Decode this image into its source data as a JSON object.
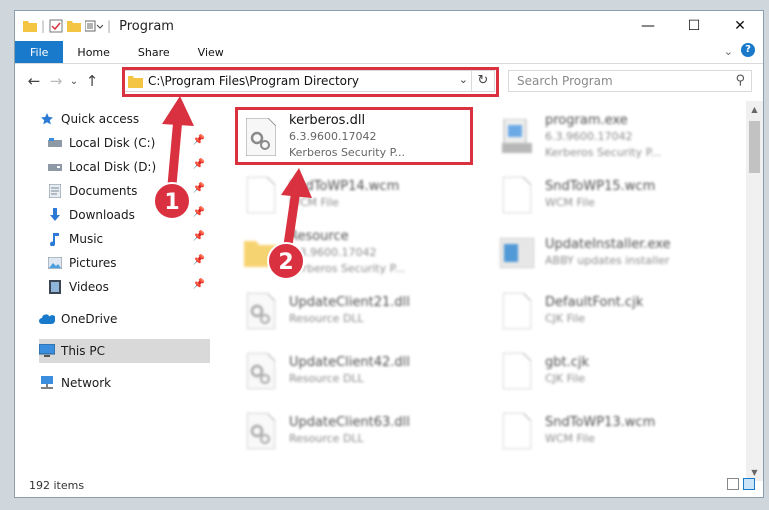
{
  "window": {
    "title": "Program"
  },
  "window_controls": {
    "minimize": "—",
    "maximize": "☐",
    "close": "✕"
  },
  "ribbon": {
    "tabs": [
      "File",
      "Home",
      "Share",
      "View"
    ]
  },
  "address": {
    "path": "C:\\Program Files\\Program Directory"
  },
  "search": {
    "placeholder": "Search Program"
  },
  "sidebar": {
    "items": [
      {
        "label": "Quick access",
        "icon": "star-icon"
      },
      {
        "label": "Local Disk (C:)",
        "icon": "drive-icon",
        "pinned": true
      },
      {
        "label": "Local Disk (D:)",
        "icon": "drive-icon",
        "pinned": true
      },
      {
        "label": "Documents",
        "icon": "documents-icon",
        "pinned": true
      },
      {
        "label": "Downloads",
        "icon": "downloads-icon",
        "pinned": true
      },
      {
        "label": "Music",
        "icon": "music-icon",
        "pinned": true
      },
      {
        "label": "Pictures",
        "icon": "pictures-icon",
        "pinned": true
      },
      {
        "label": "Videos",
        "icon": "videos-icon",
        "pinned": true
      },
      {
        "label": "OneDrive",
        "icon": "onedrive-icon"
      },
      {
        "label": "This PC",
        "icon": "pc-icon",
        "selected": true
      },
      {
        "label": "Network",
        "icon": "network-icon"
      }
    ]
  },
  "files": [
    {
      "name": "kerberos.dll",
      "line1": "6.3.9600.17042",
      "line2": "Kerberos Security P...",
      "icon": "dll-file-icon",
      "highlighted": true
    },
    {
      "name": "program.exe",
      "line1": "6.3.9600.17042",
      "line2": "Kerberos Security P...",
      "icon": "exe-file-icon"
    },
    {
      "name": "SndToWP14.wcm",
      "line1": "WCM File",
      "line2": "",
      "icon": "generic-file-icon"
    },
    {
      "name": "SndToWP15.wcm",
      "line1": "WCM File",
      "line2": "",
      "icon": "generic-file-icon"
    },
    {
      "name": "Resource",
      "line1": "6.3.9600.17042",
      "line2": "Kerberos Security P...",
      "icon": "folder-icon"
    },
    {
      "name": "UpdateInstaller.exe",
      "line1": "ABBY updates installer",
      "line2": "",
      "icon": "installer-icon"
    },
    {
      "name": "UpdateClient21.dll",
      "line1": "Resource DLL",
      "line2": "",
      "icon": "dll-file-icon"
    },
    {
      "name": "DefaultFont.cjk",
      "line1": "CJK File",
      "line2": "",
      "icon": "generic-file-icon"
    },
    {
      "name": "UpdateClient42.dll",
      "line1": "Resource DLL",
      "line2": "",
      "icon": "dll-file-icon"
    },
    {
      "name": "gbt.cjk",
      "line1": "CJK File",
      "line2": "",
      "icon": "generic-file-icon"
    },
    {
      "name": "UpdateClient63.dll",
      "line1": "Resource DLL",
      "line2": "",
      "icon": "dll-file-icon"
    },
    {
      "name": "SndToWP13.wcm",
      "line1": "WCM File",
      "line2": "",
      "icon": "generic-file-icon"
    }
  ],
  "status": {
    "count": "192 items"
  },
  "annotations": {
    "step1": "1",
    "step2": "2",
    "color": "#d9313f"
  },
  "colors": {
    "accent": "#1979ca",
    "highlight": "#d9313f"
  }
}
